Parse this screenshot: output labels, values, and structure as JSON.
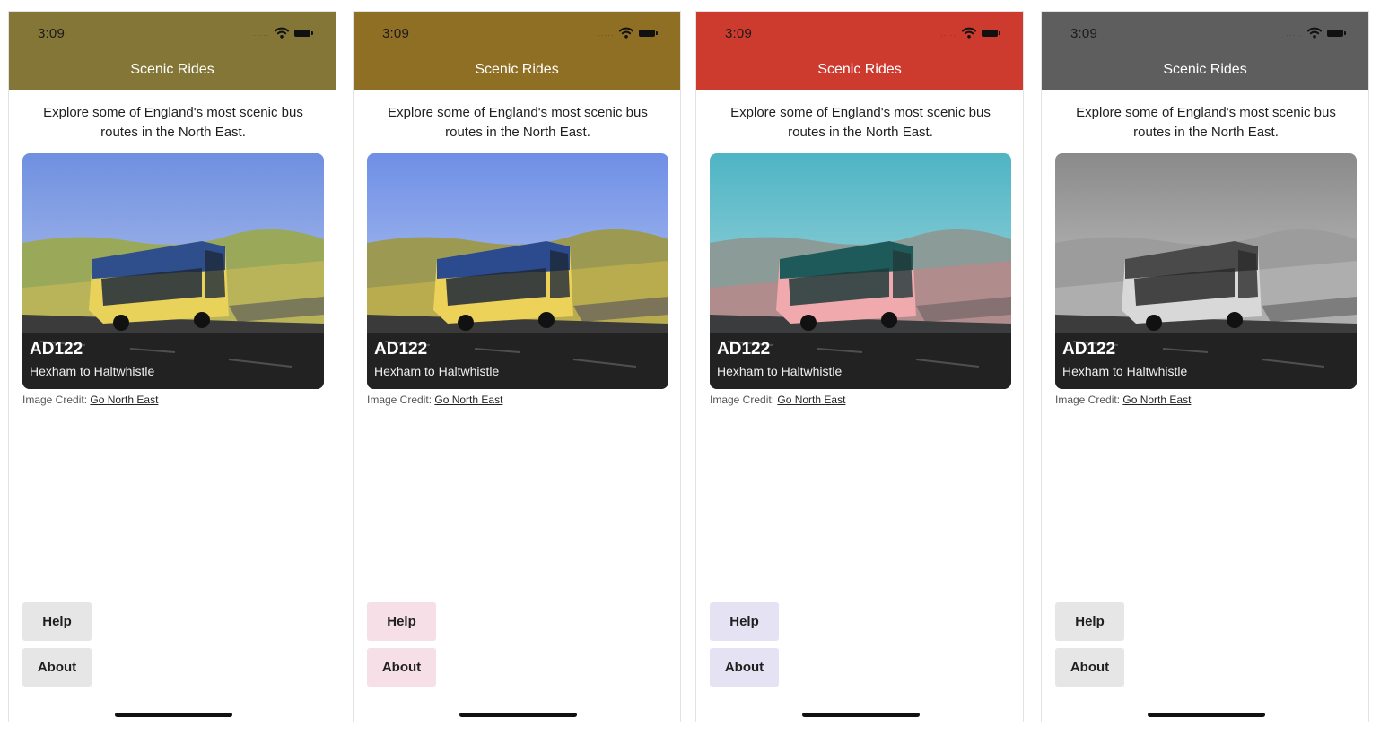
{
  "screens": [
    {
      "variant": "olive",
      "status_time": "3:09",
      "app_title": "Scenic Rides",
      "intro": "Explore some of England's most scenic bus routes in the North East.",
      "route_code": "AD122",
      "route_name": "Hexham to Haltwhistle",
      "credit_label": "Image Credit:",
      "credit_link": "Go North East",
      "help_label": "Help",
      "about_label": "About",
      "colors": {
        "header": "#847636",
        "button_bg": "#e6e6e6",
        "title_text": "#ffffff"
      }
    },
    {
      "variant": "gold",
      "status_time": "3:09",
      "app_title": "Scenic Rides",
      "intro": "Explore some of England's most scenic bus routes in the North East.",
      "route_code": "AD122",
      "route_name": "Hexham to Haltwhistle",
      "credit_label": "Image Credit:",
      "credit_link": "Go North East",
      "help_label": "Help",
      "about_label": "About",
      "colors": {
        "header": "#8f6f24",
        "button_bg": "#f6dfe6",
        "title_text": "#ffffff"
      }
    },
    {
      "variant": "red",
      "status_time": "3:09",
      "app_title": "Scenic Rides",
      "intro": "Explore some of England's most scenic bus routes in the North East.",
      "route_code": "AD122",
      "route_name": "Hexham to Haltwhistle",
      "credit_label": "Image Credit:",
      "credit_link": "Go North East",
      "help_label": "Help",
      "about_label": "About",
      "colors": {
        "header": "#cd3b2f",
        "button_bg": "#e5e3f3",
        "title_text": "#ffffff"
      }
    },
    {
      "variant": "gray",
      "status_time": "3:09",
      "app_title": "Scenic Rides",
      "intro": "Explore some of England's most scenic bus routes in the North East.",
      "route_code": "AD122",
      "route_name": "Hexham to Haltwhistle",
      "credit_label": "Image Credit:",
      "credit_link": "Go North East",
      "help_label": "Help",
      "about_label": "About",
      "colors": {
        "header": "#5e5e5e",
        "button_bg": "#e6e6e6",
        "title_text": "#ffffff"
      }
    }
  ]
}
